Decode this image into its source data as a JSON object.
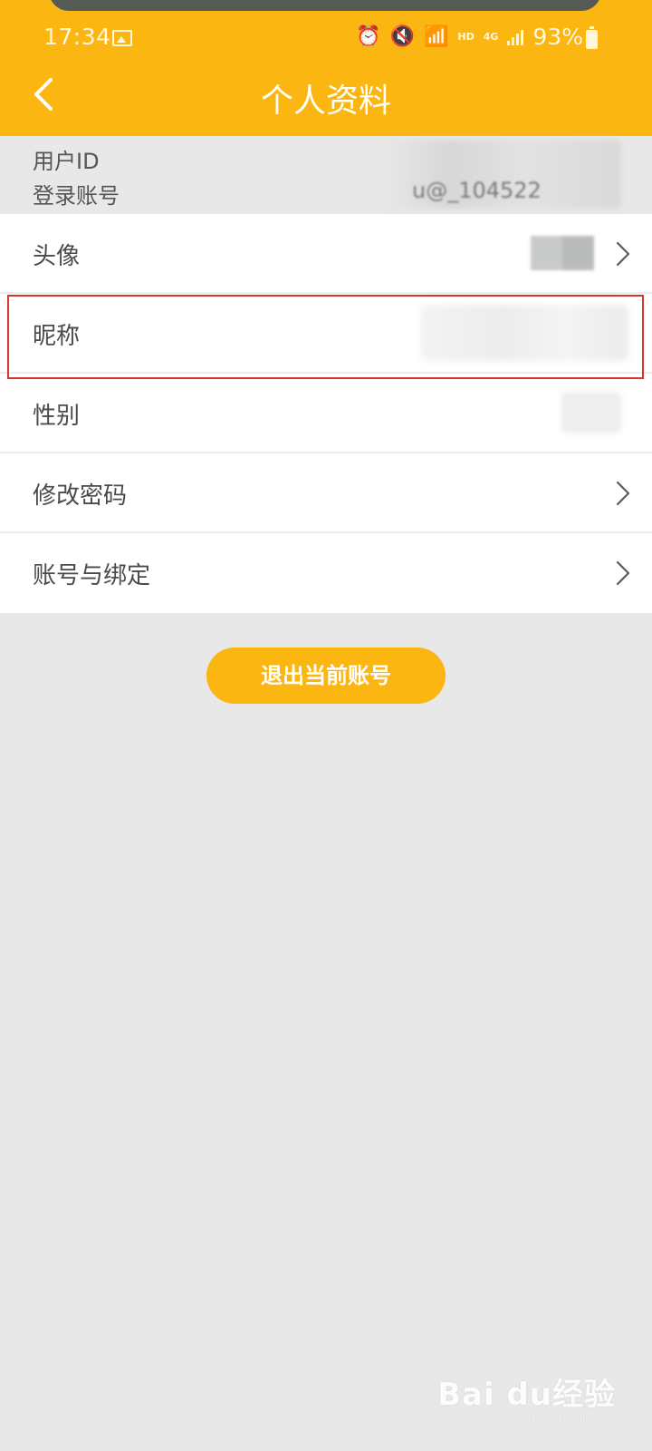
{
  "status_bar": {
    "time": "17:34",
    "network": "HD",
    "cellular": "4G",
    "battery": "93%"
  },
  "header": {
    "title": "个人资料",
    "background_color": "#fbb612"
  },
  "account_info": {
    "user_id_label": "用户ID",
    "login_account_label": "登录账号",
    "login_account_value_partial": "u@_104522"
  },
  "rows": [
    {
      "label": "头像",
      "has_chevron": true
    },
    {
      "label": "昵称",
      "has_chevron": false,
      "highlighted": true
    },
    {
      "label": "性别",
      "has_chevron": false
    },
    {
      "label": "修改密码",
      "has_chevron": true
    },
    {
      "label": "账号与绑定",
      "has_chevron": true
    }
  ],
  "logout_button": "退出当前账号",
  "watermark": {
    "brand": "Bai du经验",
    "url": "jingyan.baidu.com"
  }
}
